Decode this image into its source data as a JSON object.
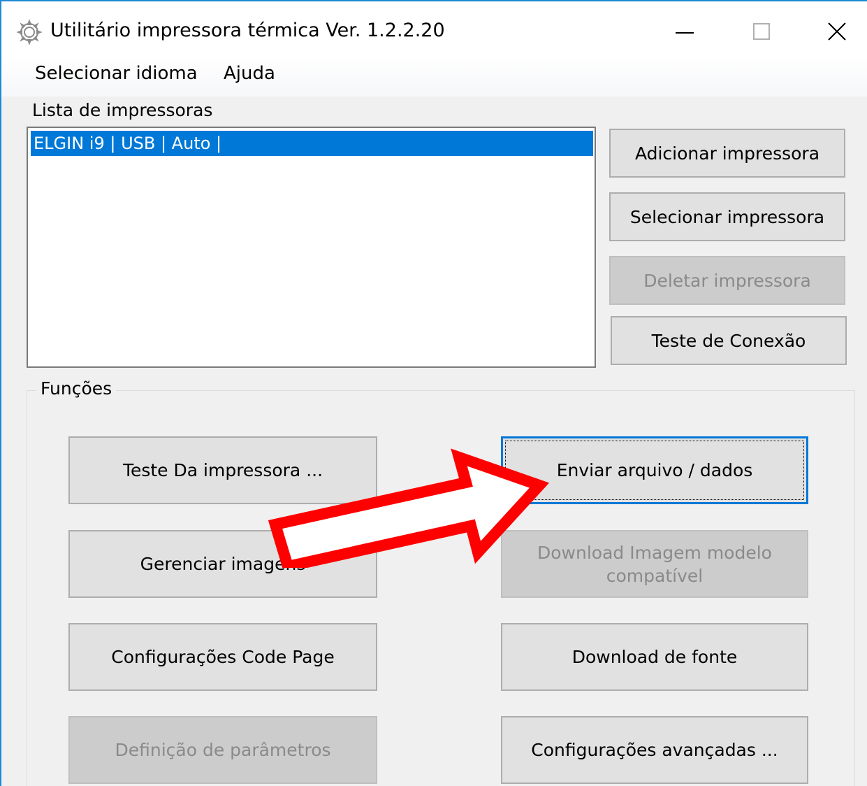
{
  "window": {
    "title": "Utilitário impressora térmica Ver. 1.2.2.20",
    "icon": "gear-icon",
    "controls": [
      "minimize-icon",
      "maximize-icon",
      "close-icon"
    ]
  },
  "menu": {
    "items": [
      "Selecionar idioma",
      "Ajuda"
    ]
  },
  "printers": {
    "label": "Lista de impressoras",
    "items": [
      "ELGIN i9 | USB | Auto |"
    ],
    "selected_index": 0
  },
  "printer_actions": {
    "add": "Adicionar impressora",
    "select": "Selecionar impressora",
    "delete": "Deletar impressora",
    "test_connection": "Teste de Conexão"
  },
  "functions": {
    "label": "Funções",
    "test_print": "Teste Da impressora ...",
    "send_file": "Enviar arquivo / dados",
    "manage_images": "Gerenciar imagens",
    "download_image": "Download Imagem modelo compatível",
    "code_page": "Configurações Code Page",
    "download_font": "Download de fonte",
    "parameters": "Definição de parâmetros",
    "advanced": "Configurações avançadas ..."
  },
  "annotation": {
    "arrow_icon": "arrow-annotation-icon",
    "arrow_color": "#ff0000"
  },
  "colors": {
    "selection": "#0078d7",
    "window_border": "#1c8ad6"
  }
}
